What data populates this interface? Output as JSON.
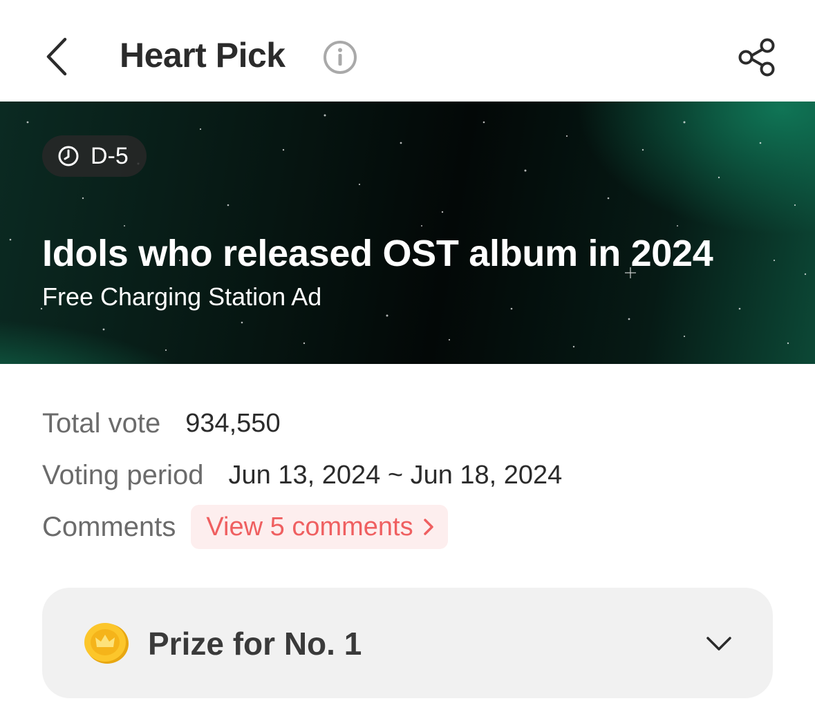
{
  "header": {
    "title": "Heart Pick",
    "back_icon": "chevron-left-icon",
    "info_icon": "info-icon",
    "share_icon": "share-icon"
  },
  "banner": {
    "dday": "D-5",
    "dday_icon": "clock-icon",
    "title": "Idols who released OST album in 2024",
    "subtitle": "Free Charging Station Ad",
    "accent_color": "#0f7a57"
  },
  "details": {
    "total_vote_label": "Total vote",
    "total_vote_value": "934,550",
    "voting_period_label": "Voting period",
    "voting_period_value": "Jun 13, 2024 ~ Jun 18, 2024",
    "comments_label": "Comments",
    "comments_button": "View 5 comments",
    "comments_color": "#ef5f60"
  },
  "prize": {
    "label": "Prize for No. 1",
    "icon": "coin-icon",
    "expand_icon": "chevron-down-icon"
  }
}
